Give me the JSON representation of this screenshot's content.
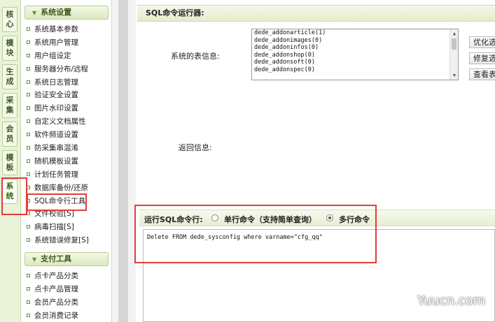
{
  "vtabs": [
    {
      "chars": [
        "核",
        "心"
      ]
    },
    {
      "chars": [
        "模",
        "块"
      ]
    },
    {
      "chars": [
        "生",
        "成"
      ]
    },
    {
      "chars": [
        "采",
        "集"
      ]
    },
    {
      "chars": [
        "会",
        "员"
      ]
    },
    {
      "chars": [
        "模",
        "板"
      ]
    },
    {
      "chars": [
        "系",
        "统"
      ]
    }
  ],
  "sidebar": {
    "section1": "系统设置",
    "items1": [
      "系统基本参数",
      "系统用户管理",
      "用户组设定",
      "服务器分布/远程",
      "系统日志管理",
      "验证安全设置",
      "图片水印设置",
      "自定义文档属性",
      "软件频道设置",
      "防采集串混淆",
      "随机模板设置",
      "计划任务管理",
      "数据库备份/还原",
      "SQL命令行工具",
      "文件校验[S]",
      "病毒扫描[S]",
      "系统错误修复[S]"
    ],
    "section2": "支付工具",
    "items2": [
      "点卡产品分类",
      "点卡产品管理",
      "会员产品分类",
      "会员消费记录"
    ]
  },
  "main": {
    "title": "SQL命令运行器:",
    "tables_label": "系统的表信息:",
    "tables": [
      "dede_addonarticle(1)",
      "dede_addonimages(0)",
      "dede_addoninfos(0)",
      "dede_addonshop(0)",
      "dede_addonsoft(0)",
      "dede_addonspec(0)"
    ],
    "side_buttons": [
      "优化选",
      "修复选",
      "查看表"
    ],
    "return_label": "返回信息:",
    "run_label": "运行SQL命令行:",
    "radio_single": "单行命令（支持简单查询）",
    "radio_multi": "多行命令",
    "sql_text": "Delete FROM dede_sysconfig where varname=\"cfg_qq\""
  },
  "watermark": "Yuucn.com"
}
